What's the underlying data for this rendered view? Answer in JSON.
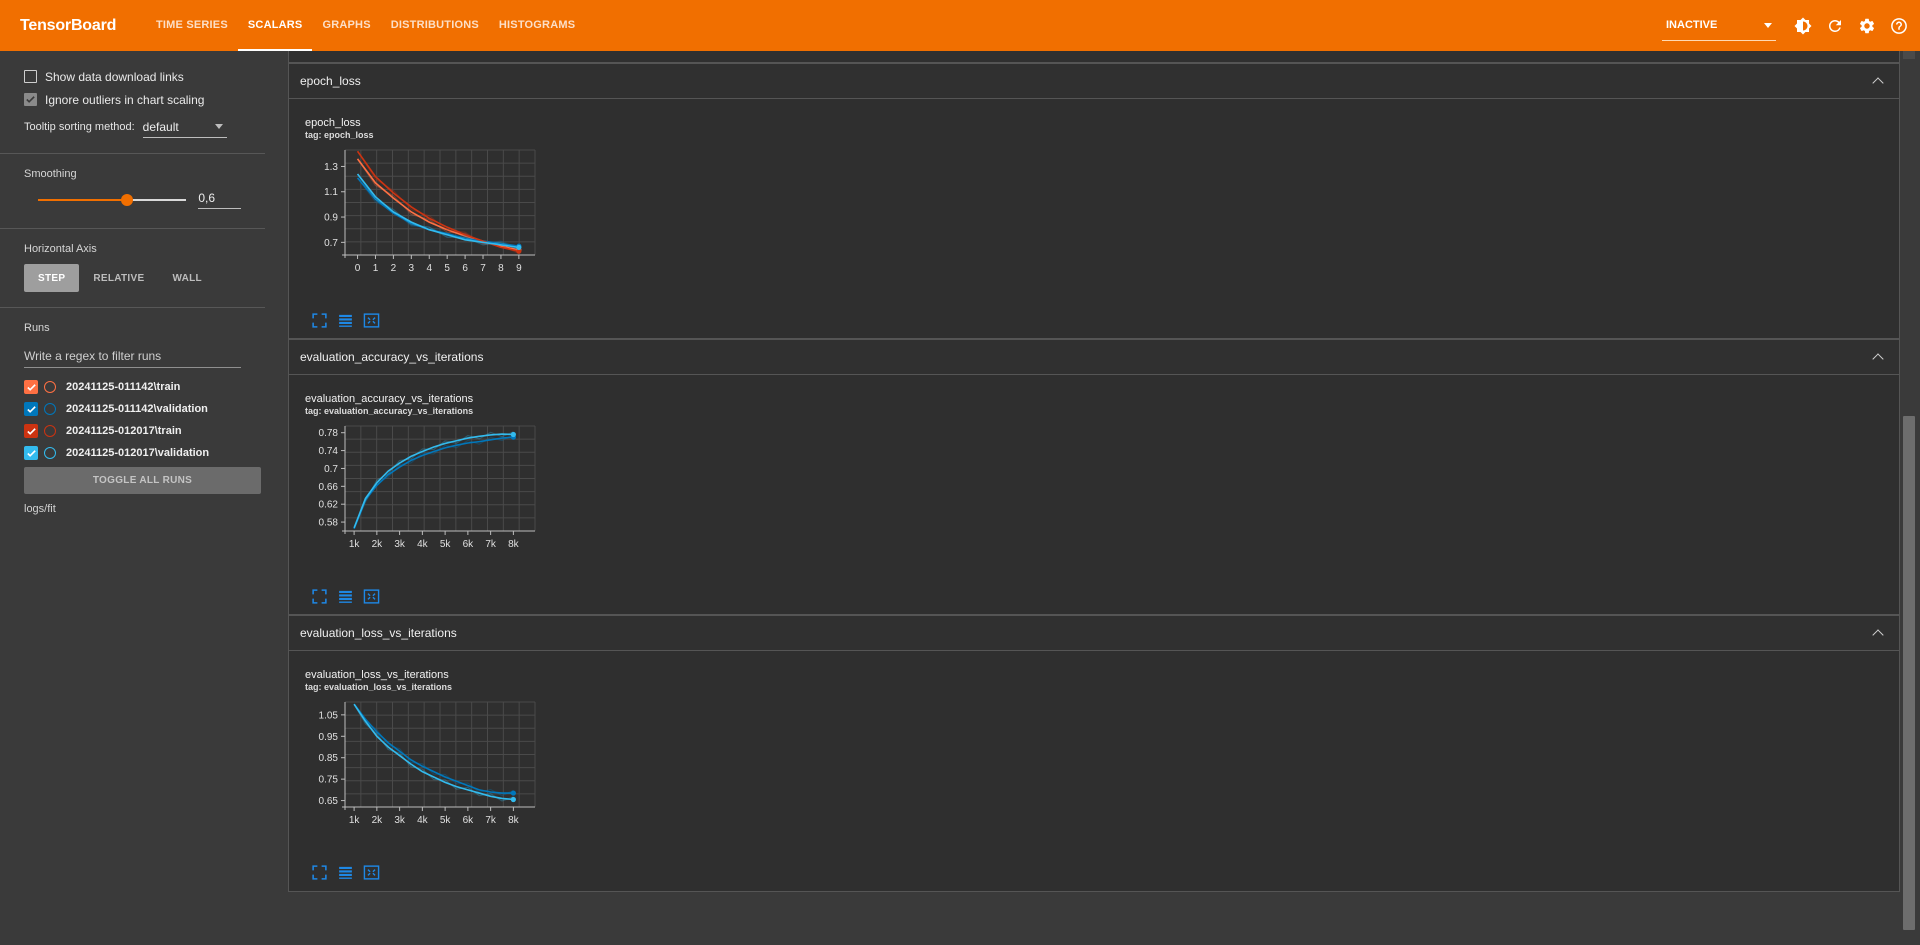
{
  "app": {
    "brand": "TensorBoard",
    "tabs": [
      {
        "label": "TIME SERIES",
        "active": false
      },
      {
        "label": "SCALARS",
        "active": true
      },
      {
        "label": "GRAPHS",
        "active": false
      },
      {
        "label": "DISTRIBUTIONS",
        "active": false
      },
      {
        "label": "HISTOGRAMS",
        "active": false
      }
    ],
    "status_select": "INACTIVE",
    "icons": [
      "brightness-icon",
      "refresh-icon",
      "settings-icon",
      "help-icon"
    ],
    "accent_color": "#f16f00"
  },
  "sidebar": {
    "show_download_links": "Show data download links",
    "ignore_outliers": "Ignore outliers in chart scaling",
    "tooltip_label": "Tooltip sorting method:",
    "tooltip_value": "default",
    "smoothing_title": "Smoothing",
    "smoothing_value": "0,6",
    "smoothing_fraction": 0.6,
    "axis_title": "Horizontal Axis",
    "axis_options": [
      "STEP",
      "RELATIVE",
      "WALL"
    ],
    "axis_selected": "STEP",
    "runs_title": "Runs",
    "filter_placeholder": "Write a regex to filter runs",
    "runs": [
      {
        "name": "20241125-011142\\train",
        "color": "#ff7043"
      },
      {
        "name": "20241125-011142\\validation",
        "color": "#0077bb"
      },
      {
        "name": "20241125-012017\\train",
        "color": "#cc3311"
      },
      {
        "name": "20241125-012017\\validation",
        "color": "#33bbee"
      }
    ],
    "toggle_label": "TOGGLE ALL RUNS",
    "logdir": "logs/fit"
  },
  "groups": [
    {
      "header": "epoch_loss",
      "title": "epoch_loss",
      "tag": "tag: epoch_loss"
    },
    {
      "header": "evaluation_accuracy_vs_iterations",
      "title": "evaluation_accuracy_vs_iterations",
      "tag": "tag: evaluation_accuracy_vs_iterations"
    },
    {
      "header": "evaluation_loss_vs_iterations",
      "title": "evaluation_loss_vs_iterations",
      "tag": "tag: evaluation_loss_vs_iterations"
    }
  ],
  "chart_data": [
    {
      "type": "line",
      "title": "epoch_loss",
      "x": [
        0,
        1,
        2,
        3,
        4,
        5,
        6,
        7,
        8,
        9
      ],
      "xticks": [
        "0",
        "1",
        "2",
        "3",
        "4",
        "5",
        "6",
        "7",
        "8",
        "9"
      ],
      "yticks": [
        0.7,
        0.9,
        1.1,
        1.3
      ],
      "xlim": [
        -0.7,
        9.9
      ],
      "ylim": [
        0.6,
        1.43
      ],
      "series": [
        {
          "name": "20241125-011142\\train",
          "color": "#ff7043",
          "values": [
            1.36,
            1.17,
            1.05,
            0.94,
            0.86,
            0.8,
            0.75,
            0.71,
            0.67,
            0.64
          ]
        },
        {
          "name": "20241125-011142\\validation",
          "color": "#0077bb",
          "values": [
            1.21,
            1.04,
            0.93,
            0.85,
            0.8,
            0.77,
            0.73,
            0.71,
            0.69,
            0.67
          ]
        },
        {
          "name": "20241125-012017\\train",
          "color": "#cc3311",
          "values": [
            1.42,
            1.22,
            1.09,
            0.98,
            0.89,
            0.82,
            0.76,
            0.71,
            0.66,
            0.63
          ]
        },
        {
          "name": "20241125-012017\\validation",
          "color": "#33bbee",
          "values": [
            1.24,
            1.06,
            0.94,
            0.86,
            0.8,
            0.76,
            0.72,
            0.7,
            0.68,
            0.66
          ]
        }
      ]
    },
    {
      "type": "line",
      "title": "evaluation_accuracy_vs_iterations",
      "x": [
        1000,
        1500,
        2000,
        2500,
        3000,
        3500,
        4000,
        4500,
        5000,
        5500,
        6000,
        6500,
        7000,
        7500,
        8000
      ],
      "xticks": [
        "1k",
        "2k",
        "3k",
        "4k",
        "5k",
        "6k",
        "7k",
        "8k"
      ],
      "yticks": [
        0.58,
        0.62,
        0.66,
        0.7,
        0.74,
        0.78
      ],
      "xlim": [
        600,
        8950
      ],
      "ylim": [
        0.56,
        0.795
      ],
      "series": [
        {
          "name": "20241125-011142\\validation",
          "color": "#0077bb",
          "values": [
            0.565,
            0.63,
            0.662,
            0.686,
            0.703,
            0.718,
            0.729,
            0.738,
            0.746,
            0.752,
            0.757,
            0.76,
            0.764,
            0.768,
            0.77
          ]
        },
        {
          "name": "20241125-012017\\validation",
          "color": "#33bbee",
          "values": [
            0.567,
            0.633,
            0.668,
            0.694,
            0.712,
            0.727,
            0.738,
            0.748,
            0.756,
            0.762,
            0.768,
            0.772,
            0.775,
            0.777,
            0.776
          ]
        }
      ]
    },
    {
      "type": "line",
      "title": "evaluation_loss_vs_iterations",
      "x": [
        1000,
        1500,
        2000,
        2500,
        3000,
        3500,
        4000,
        4500,
        5000,
        5500,
        6000,
        6500,
        7000,
        7500,
        8000
      ],
      "xticks": [
        "1k",
        "2k",
        "3k",
        "4k",
        "5k",
        "6k",
        "7k",
        "8k"
      ],
      "yticks": [
        0.65,
        0.75,
        0.85,
        0.95,
        1.05
      ],
      "xlim": [
        600,
        8950
      ],
      "ylim": [
        0.62,
        1.11
      ],
      "series": [
        {
          "name": "20241125-011142\\validation",
          "color": "#0077bb",
          "values": [
            1.1,
            1.03,
            0.97,
            0.92,
            0.88,
            0.84,
            0.81,
            0.785,
            0.76,
            0.74,
            0.72,
            0.7,
            0.69,
            0.685,
            0.685
          ]
        },
        {
          "name": "20241125-012017\\validation",
          "color": "#33bbee",
          "values": [
            1.1,
            1.02,
            0.95,
            0.9,
            0.86,
            0.82,
            0.785,
            0.76,
            0.735,
            0.715,
            0.7,
            0.685,
            0.67,
            0.66,
            0.655
          ]
        }
      ]
    }
  ]
}
